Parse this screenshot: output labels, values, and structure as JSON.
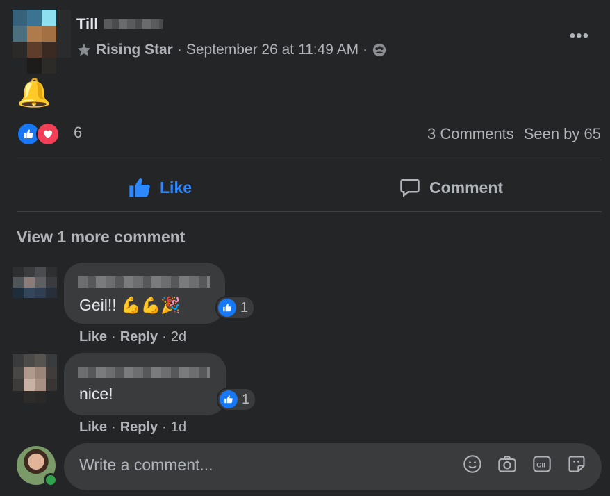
{
  "post": {
    "author": "Till",
    "badge": "Rising Star",
    "separator": "·",
    "timestamp": "September 26 at 11:49 AM",
    "content_emoji": "🔔"
  },
  "reactions": {
    "count": "6",
    "comments": "3 Comments",
    "seen": "Seen by 65"
  },
  "actions": {
    "like": "Like",
    "comment": "Comment"
  },
  "view_more": "View 1 more comment",
  "comments": [
    {
      "text": "Geil!! 💪💪🎉",
      "reaction_count": "1",
      "like": "Like",
      "reply": "Reply",
      "age": "2d"
    },
    {
      "text": "nice!",
      "reaction_count": "1",
      "like": "Like",
      "reply": "Reply",
      "age": "1d"
    }
  ],
  "composer": {
    "placeholder": "Write a comment..."
  },
  "colors": {
    "background": "#242526",
    "accent": "#2d88ff",
    "love": "#f33e58",
    "online": "#31a24c"
  }
}
